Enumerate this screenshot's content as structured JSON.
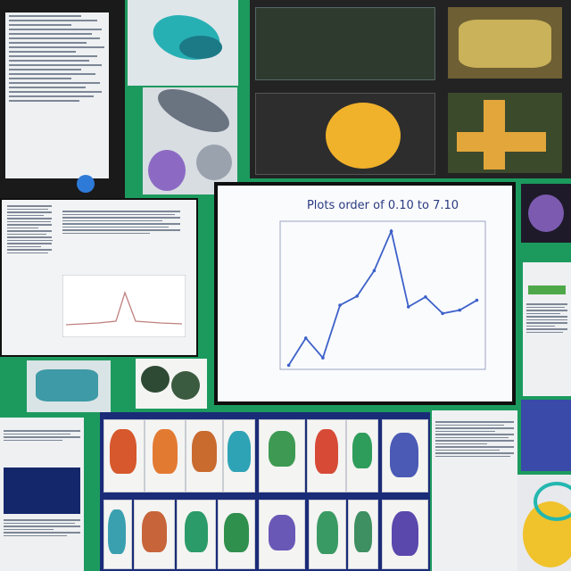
{
  "chart_data": {
    "type": "line",
    "title": "Plots order of 0.10 to 7.10",
    "xlabel": "",
    "ylabel": "",
    "x": [
      1,
      2,
      3,
      4,
      5,
      6,
      7,
      8,
      9,
      10,
      11,
      12
    ],
    "series": [
      {
        "values": [
          5,
          38,
          14,
          78,
          89,
          120,
          168,
          76,
          88,
          68,
          72,
          84
        ]
      }
    ],
    "xlim": [
      0.5,
      12.5
    ],
    "ylim": [
      0,
      180
    ],
    "grid": false,
    "line_color": "#3d61c9"
  },
  "colors": {
    "background": "#1c9a5e",
    "panel_dark": "#1a1a1a",
    "navy": "#15276b",
    "accent_orange": "#f0b12b",
    "accent_teal": "#23b7b0",
    "accent_purple": "#7c5ab0"
  }
}
